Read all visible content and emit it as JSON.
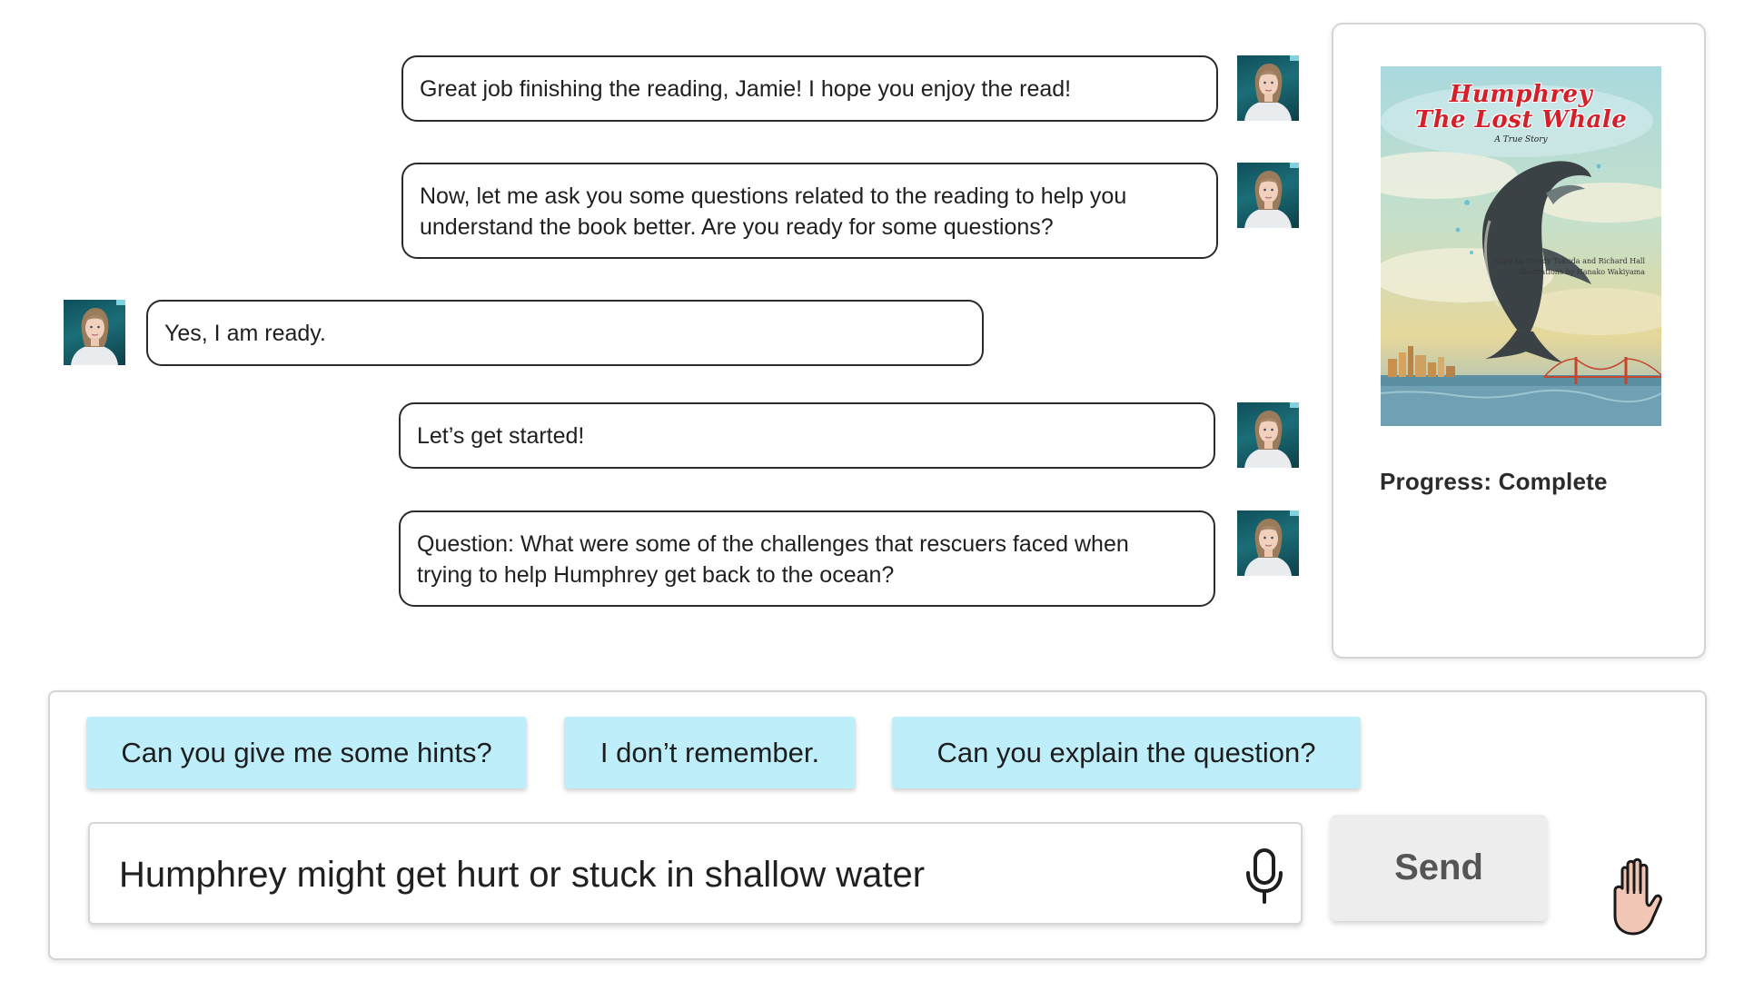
{
  "chat": {
    "messages": [
      {
        "sender": "tutor",
        "text": "Great job finishing the reading, Jamie! I hope you enjoy the read!"
      },
      {
        "sender": "tutor",
        "line1": "Now, let me ask you some questions related to the reading to help you",
        "line2": "understand the book better. Are you ready for some questions?"
      },
      {
        "sender": "student",
        "text": "Yes, I am ready."
      },
      {
        "sender": "tutor",
        "text": "Let’s get started!"
      },
      {
        "sender": "tutor",
        "line1": "Question: What were some of the challenges that rescuers faced when",
        "line2": "trying to help Humphrey get back to the ocean?"
      }
    ]
  },
  "book": {
    "cover_title_line1": "Humphrey",
    "cover_title_line2": "The Lost Whale",
    "cover_subtitle": "A True Story",
    "cover_credit_line1": "story by Wendy Tokuda and Richard Hall",
    "cover_credit_line2": "illustrations by Hanako Wakiyama",
    "progress_text": "Progress: Complete"
  },
  "suggestions": [
    "Can you give me some hints?",
    "I don’t remember.",
    "Can you explain the question?"
  ],
  "input": {
    "value": "Humphrey might get hurt or stuck in shallow water"
  },
  "buttons": {
    "send_label": "Send"
  },
  "icons": {
    "mic": "microphone-icon",
    "hand": "raise-hand-icon",
    "avatar": "avatar"
  },
  "colors": {
    "suggestion_chip": "#bdeefa",
    "send_button": "#ededed",
    "cover_title": "#d3202a"
  }
}
